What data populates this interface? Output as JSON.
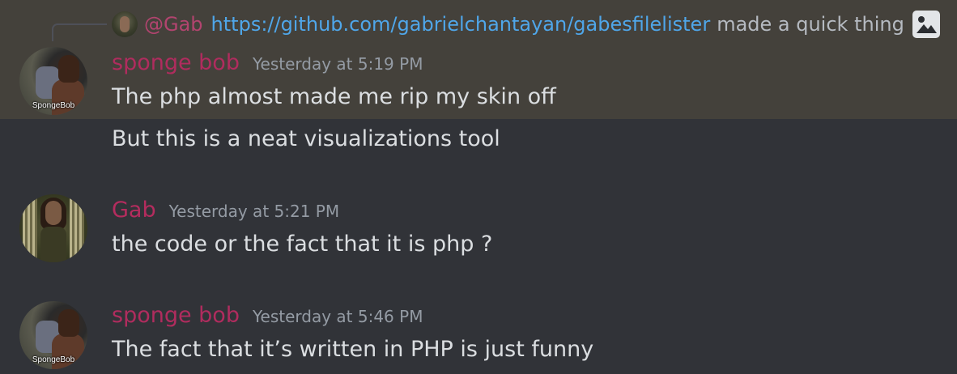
{
  "reply": {
    "mention": "@Gab",
    "link": "https://github.com/gabrielchantayan/gabesfilelister",
    "text": "made a quick thing"
  },
  "messages": [
    {
      "username": "sponge bob",
      "timestamp": "Yesterday at 5:19 PM",
      "avatar_caption": "SpongeBob",
      "lines": [
        "The php almost made me rip my skin off",
        "But this is a neat visualizations tool"
      ]
    },
    {
      "username": "Gab",
      "timestamp": "Yesterday at 5:21 PM",
      "lines": [
        "the code or the fact that it is php ?"
      ]
    },
    {
      "username": "sponge bob",
      "timestamp": "Yesterday at 5:46 PM",
      "avatar_caption": "SpongeBob",
      "lines": [
        "The fact that it’s written in PHP is just funny"
      ]
    }
  ],
  "colors": {
    "background": "#313338",
    "highlight": "#44413b",
    "username": "#b02c5e",
    "link": "#4fa6e9",
    "text": "#dbdee1",
    "timestamp": "#949ba4"
  }
}
